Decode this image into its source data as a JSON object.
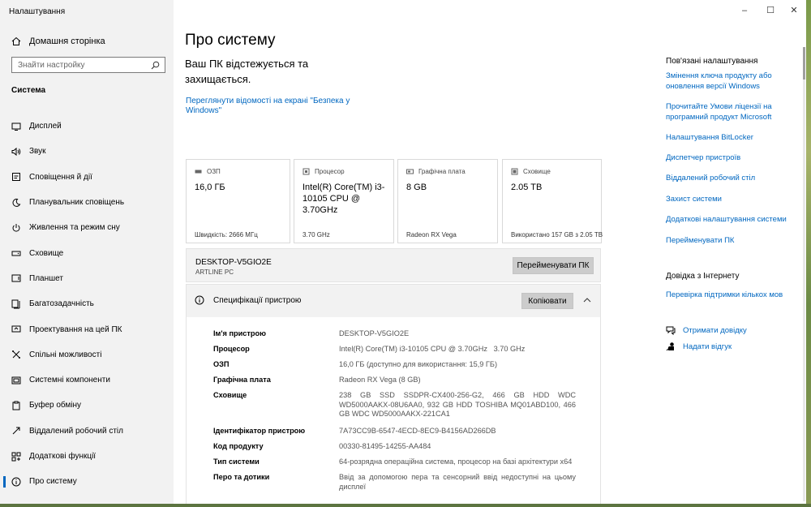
{
  "window": {
    "title": "Налаштування",
    "controls": {
      "minimize": "–",
      "maximize": "☐",
      "close": "✕"
    }
  },
  "sidebar": {
    "home_label": "Домашня сторінка",
    "search_placeholder": "Знайти настройку",
    "section_title": "Система",
    "items": [
      {
        "label": "Дисплей",
        "icon": "display-icon"
      },
      {
        "label": "Звук",
        "icon": "sound-icon"
      },
      {
        "label": "Сповіщення й дії",
        "icon": "notifications-icon"
      },
      {
        "label": "Планувальник сповіщень",
        "icon": "moon-icon"
      },
      {
        "label": "Живлення та режим сну",
        "icon": "power-icon"
      },
      {
        "label": "Сховище",
        "icon": "storage-icon"
      },
      {
        "label": "Планшет",
        "icon": "tablet-icon"
      },
      {
        "label": "Багатозадачність",
        "icon": "multitasking-icon"
      },
      {
        "label": "Проектування на цей ПК",
        "icon": "projecting-icon"
      },
      {
        "label": "Спільні можливості",
        "icon": "shared-experiences-icon"
      },
      {
        "label": "Системні компоненти",
        "icon": "system-components-icon"
      },
      {
        "label": "Буфер обміну",
        "icon": "clipboard-icon"
      },
      {
        "label": "Віддалений робочий стіл",
        "icon": "remote-desktop-icon"
      },
      {
        "label": "Додаткові функції",
        "icon": "optional-features-icon"
      },
      {
        "label": "Про систему",
        "icon": "info-icon",
        "active": true
      }
    ]
  },
  "main": {
    "title": "Про систему",
    "status_text": "Ваш ПК відстежується та захищається.",
    "security_link": "Переглянути відомості на екрані \"Безпека у Windows\""
  },
  "cards": [
    {
      "title": "ОЗП",
      "value": "16,0 ГБ",
      "sub": "Швидкість: 2666 МГц",
      "icon": "ram-icon"
    },
    {
      "title": "Процесор",
      "value": "Intel(R) Core(TM) i3-10105 CPU @ 3.70GHz",
      "sub": "3.70 GHz",
      "icon": "cpu-icon"
    },
    {
      "title": "Графічна плата",
      "value": "8 GB",
      "sub": "Radeon RX Vega",
      "icon": "gpu-icon"
    },
    {
      "title": "Сховище",
      "value": "2.05 TB",
      "sub": "Використано 157 GB з 2.05 TB",
      "icon": "drive-icon"
    }
  ],
  "pc": {
    "name": "DESKTOP-V5GIO2E",
    "model": "ARTLINE PC",
    "rename_button": "Перейменувати ПК"
  },
  "specs": {
    "title": "Специфікації пристрою",
    "copy_button": "Копіювати",
    "rows": [
      {
        "key": "Ім'я пристрою",
        "value": "DESKTOP-V5GIO2E"
      },
      {
        "key": "Процесор",
        "value": "Intel(R) Core(TM) i3-10105 CPU @ 3.70GHz   3.70 GHz"
      },
      {
        "key": "ОЗП",
        "value": "16,0 ГБ (доступно для використання: 15,9 ГБ)"
      },
      {
        "key": "Графічна плата",
        "value": "Radeon RX Vega (8 GB)"
      },
      {
        "key": "Сховище",
        "value": "238 GB SSD SSDPR-CX400-256-G2, 466 GB HDD WDC WD5000AAKX-08U6AA0, 932 GB HDD TOSHIBA MQ01ABD100, 466 GB WDC WD5000AAKX-221CA1"
      },
      {
        "key": "Ідентифікатор пристрою",
        "value": "7A73CC9B-6547-4ECD-8EC9-B4156AD266DB"
      },
      {
        "key": "Код продукту",
        "value": "00330-81495-14255-AA484"
      },
      {
        "key": "Тип системи",
        "value": "64-розрядна операційна система, процесор на базі архітектури x64"
      },
      {
        "key": "Перо та дотики",
        "value": "Ввід за допомогою пера та сенсорний ввід недоступні на цьому дисплеї"
      }
    ]
  },
  "related": {
    "heading": "Пов'язані налаштування",
    "links": [
      "Змінення ключа продукту або оновлення версії Windows",
      "Прочитайте Умови ліцензії на програмний продукт Microsoft",
      "Налаштування BitLocker",
      "Диспетчер пристроїв",
      "Віддалений робочий стіл",
      "Захист системи",
      "Додаткові налаштування системи",
      "Перейменувати ПК"
    ],
    "web_heading": "Довідка з Інтернету",
    "web_links": [
      "Перевірка підтримки кількох мов"
    ],
    "help_label": "Отримати довідку",
    "feedback_label": "Надати відгук"
  }
}
